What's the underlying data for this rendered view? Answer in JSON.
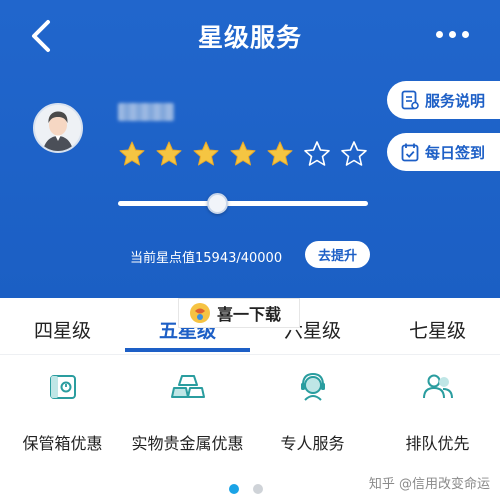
{
  "header": {
    "title": "星级服务",
    "back_icon": "chevron-left-icon",
    "more_icon": "more-icon"
  },
  "profile": {
    "username": "",
    "stars_total": 7,
    "stars_filled": 5,
    "star_color": "#f5c542",
    "progress_fraction": 0.399
  },
  "side_buttons": {
    "service_desc": "服务说明",
    "daily_signin": "每日签到"
  },
  "points": {
    "text": "当前星点值15943/40000",
    "upgrade_label": "去提升"
  },
  "tabs": [
    {
      "label": "四星级",
      "active": false
    },
    {
      "label": "五星级",
      "active": true
    },
    {
      "label": "六星级",
      "active": false
    },
    {
      "label": "七星级",
      "active": false
    }
  ],
  "watermark": {
    "text": "喜一下载"
  },
  "benefits": [
    {
      "label": "保管箱优惠",
      "icon": "safe-box-icon"
    },
    {
      "label": "实物贵金属优惠",
      "icon": "gold-bars-icon"
    },
    {
      "label": "专人服务",
      "icon": "customer-service-icon"
    },
    {
      "label": "排队优先",
      "icon": "queue-priority-icon"
    }
  ],
  "pagination": {
    "pages": 2,
    "current": 1
  },
  "source_credit": "知乎 @信用改变命运",
  "colors": {
    "primary": "#1d5fc6",
    "header_bg": "#1e62c9",
    "icon_teal": "#2a9d9f",
    "dot_active": "#1aa3e6"
  }
}
